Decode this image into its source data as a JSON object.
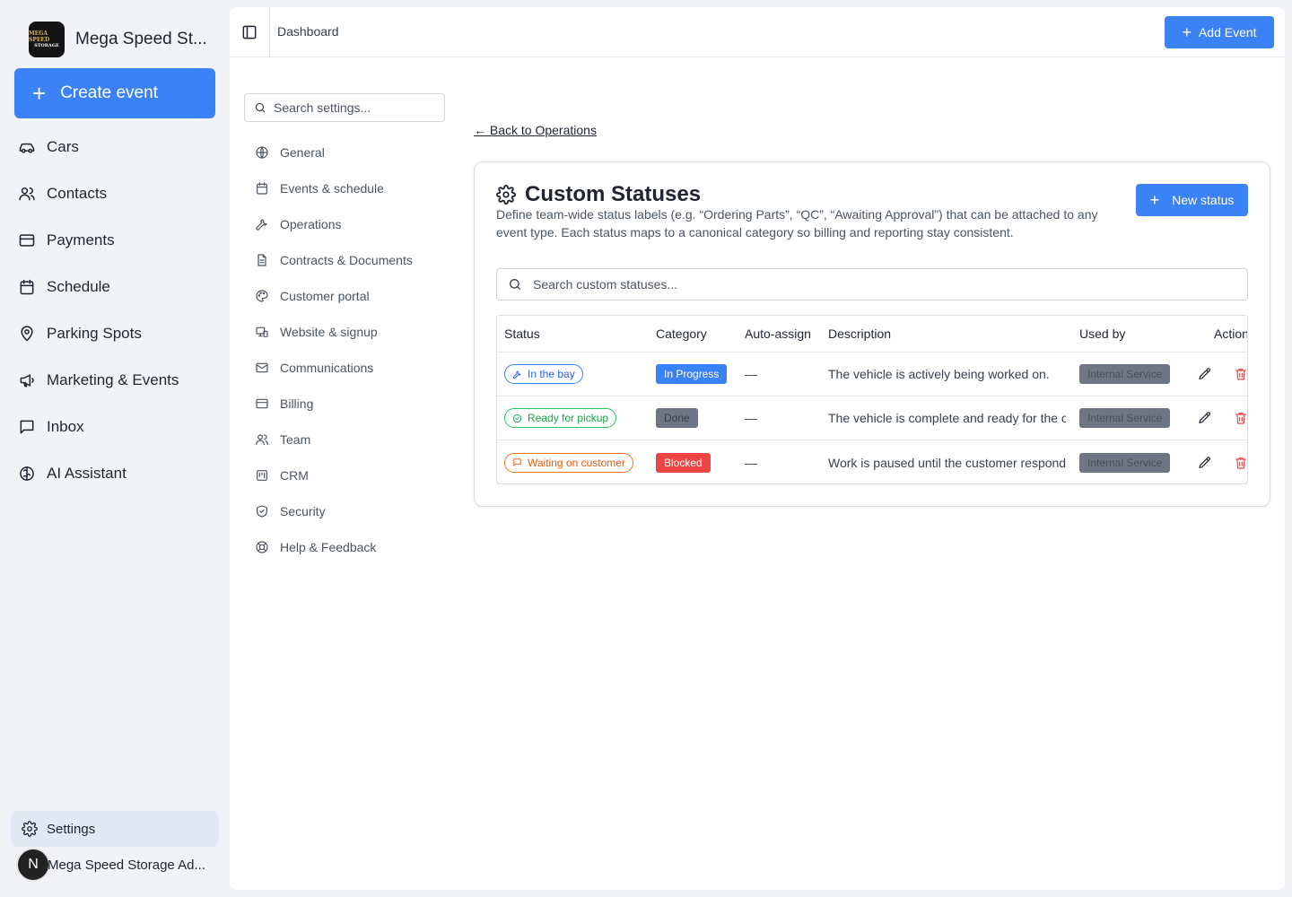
{
  "brand": {
    "name": "Mega Speed St...",
    "logo_line1": "MEGA SPEED",
    "logo_line2": "STORAGE"
  },
  "sidebar": {
    "create_label": "Create event",
    "items": [
      {
        "label": "Cars",
        "icon": "car-icon"
      },
      {
        "label": "Contacts",
        "icon": "users-icon"
      },
      {
        "label": "Payments",
        "icon": "credit-card-icon"
      },
      {
        "label": "Schedule",
        "icon": "calendar-icon"
      },
      {
        "label": "Parking Spots",
        "icon": "map-pin-icon"
      },
      {
        "label": "Marketing & Events",
        "icon": "megaphone-icon"
      },
      {
        "label": "Inbox",
        "icon": "message-square-icon"
      },
      {
        "label": "AI Assistant",
        "icon": "brain-icon"
      }
    ],
    "settings_label": "Settings",
    "user_initial": "N",
    "user_name": "Mega Speed Storage Ad..."
  },
  "topbar": {
    "breadcrumb": "Dashboard",
    "add_event_label": "Add Event"
  },
  "settings_nav": {
    "search_placeholder": "Search settings...",
    "items": [
      {
        "label": "General"
      },
      {
        "label": "Events & schedule"
      },
      {
        "label": "Operations"
      },
      {
        "label": "Contracts & Documents"
      },
      {
        "label": "Customer portal"
      },
      {
        "label": "Website & signup"
      },
      {
        "label": "Communications"
      },
      {
        "label": "Billing"
      },
      {
        "label": "Team"
      },
      {
        "label": "CRM"
      },
      {
        "label": "Security"
      },
      {
        "label": "Help & Feedback"
      }
    ]
  },
  "content": {
    "back_link": "← Back to Operations",
    "title": "Custom Statuses",
    "description": "Define team-wide status labels (e.g. “Ordering Parts”, “QC”, “Awaiting Approval”) that can be attached to any event type. Each status maps to a canonical category so billing and reporting stay consistent.",
    "new_status_label": "New status",
    "search_placeholder": "Search custom statuses...",
    "table": {
      "headers": {
        "status": "Status",
        "category": "Category",
        "auto": "Auto-assign",
        "description": "Description",
        "used_by": "Used by",
        "actions": "Actions"
      },
      "rows": [
        {
          "status": "In the bay",
          "status_color": "#3b82f6",
          "category": "In Progress",
          "auto": "—",
          "description": "The vehicle is actively being worked on.",
          "used_by": "Internal Service"
        },
        {
          "status": "Ready for pickup",
          "status_color": "#22c55e",
          "category": "Done",
          "auto": "—",
          "description": "The vehicle is complete and ready for the customer.",
          "used_by": "Internal Service"
        },
        {
          "status": "Waiting on customer",
          "status_color": "#f97316",
          "category": "Blocked",
          "auto": "—",
          "description": "Work is paused until the customer responds.",
          "used_by": "Internal Service"
        }
      ]
    }
  },
  "colors": {
    "accent": "#3b82f6",
    "danger": "#ef4444",
    "success": "#22c55e",
    "warning": "#f97316"
  }
}
